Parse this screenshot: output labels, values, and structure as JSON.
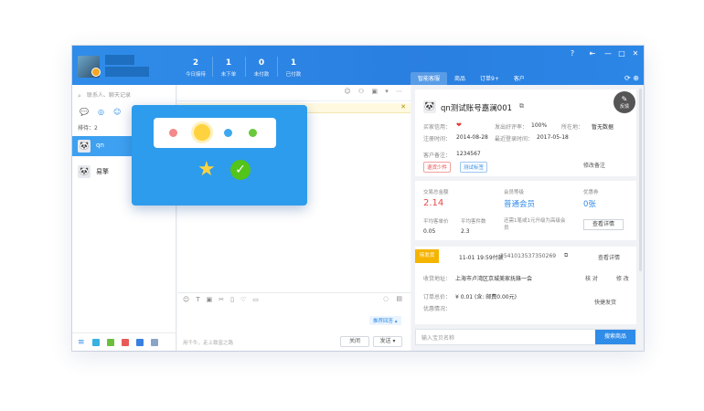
{
  "header": {
    "stats": [
      {
        "num": "2",
        "label": "今日接待"
      },
      {
        "num": "1",
        "label": "未下单"
      },
      {
        "num": "0",
        "label": "未付款"
      },
      {
        "num": "1",
        "label": "已付款"
      }
    ],
    "right_tabs": [
      "智能客服",
      "商品",
      "订单9+",
      "客户"
    ],
    "window_controls": [
      "?",
      "⇤",
      "—",
      "□",
      "✕"
    ]
  },
  "left": {
    "search_placeholder": "联系人、聊天记录",
    "queue": "排待：2",
    "contacts": [
      {
        "name": "qn",
        "avatar": "🐼"
      },
      {
        "name": "易擎",
        "avatar": "🐼"
      }
    ]
  },
  "chat": {
    "quick_reply": "推荐回答 ▴",
    "input_hint": "用千牛，走上致富之路",
    "close_label": "关闭",
    "send_label": "发送 ▾"
  },
  "popup": {
    "dot_colors": [
      "#f4888a",
      "#ffd23f",
      "#3ea8f0",
      "#68c93a"
    ]
  },
  "right": {
    "fab_label": "反馈",
    "customer": {
      "name": "qn测试账号嘉澜001",
      "buyer_credit_label": "买家信用：",
      "buyer_credit": "❤",
      "praise_label": "发出好评率：",
      "praise": "100%",
      "location_label": "所在地：",
      "location": "暂无数据",
      "register_label": "注册时间：",
      "register": "2014-08-28",
      "last_login_label": "最近登录时间：",
      "last_login": "2017-05-18",
      "note_label": "客户备注：",
      "note": "1234567",
      "tag1": "退货少件",
      "tag2": "测试标签",
      "edit_note": "修改备注"
    },
    "trade": {
      "total_label": "交易总金额",
      "total": "2.14",
      "level_label": "会员等级",
      "level": "普通会员",
      "coupon_label": "优惠券",
      "coupon": "0张",
      "avg_price_label": "平均客单价",
      "avg_price": "0.05",
      "avg_items_label": "平均客件数",
      "avg_items": "2.3",
      "upgrade_text": "还需1笔或1元升级为高级会员",
      "detail_btn": "查看详情"
    },
    "order": {
      "status": "待发货",
      "time": "11-01 19:59付款",
      "order_no": "2541013537350269",
      "view_detail": "查看详情",
      "address_label": "收货地址：",
      "address": "上海市卢湾区京城美家抚錄一会",
      "verify": "核 对",
      "modify": "修 改",
      "total_label": "订单总价：",
      "total": "¥ 0.01 (含: 邮费0.00元)",
      "discount_label": "优惠情况：",
      "ship": "快捷发货"
    },
    "search_placeholder": "输入宝贝名称",
    "search_btn": "搜索商品"
  }
}
